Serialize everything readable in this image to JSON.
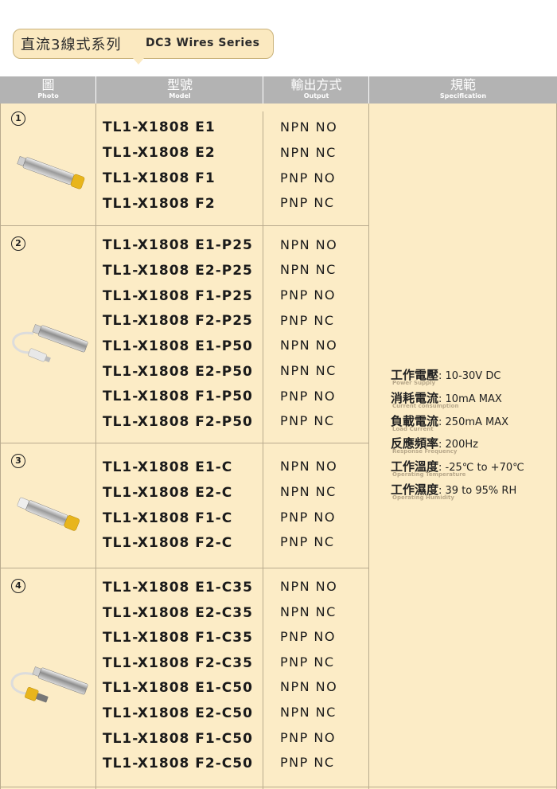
{
  "title": {
    "cn": "直流3線式系列",
    "en": "DC3 Wires Series"
  },
  "header": {
    "photo": {
      "cn": "圖",
      "en": "Photo"
    },
    "model": {
      "cn": "型號",
      "en": "Model"
    },
    "output": {
      "cn": "輸出方式",
      "en": "Output"
    },
    "spec": {
      "cn": "規範",
      "en": "Specification"
    }
  },
  "groups": [
    {
      "number": "1",
      "rows": [
        {
          "model": "TL1-X1808 E1",
          "output": "NPN NO"
        },
        {
          "model": "TL1-X1808 E2",
          "output": "NPN NC"
        },
        {
          "model": "TL1-X1808 F1",
          "output": "PNP NO"
        },
        {
          "model": "TL1-X1808 F2",
          "output": "PNP NC"
        }
      ]
    },
    {
      "number": "2",
      "rows": [
        {
          "model": "TL1-X1808 E1-P25",
          "output": "NPN NO"
        },
        {
          "model": "TL1-X1808 E2-P25",
          "output": "NPN NC"
        },
        {
          "model": "TL1-X1808 F1-P25",
          "output": "PNP NO"
        },
        {
          "model": "TL1-X1808 F2-P25",
          "output": "PNP NC"
        },
        {
          "model": "TL1-X1808 E1-P50",
          "output": "NPN NO"
        },
        {
          "model": "TL1-X1808 E2-P50",
          "output": "NPN NC"
        },
        {
          "model": "TL1-X1808 F1-P50",
          "output": "PNP NO"
        },
        {
          "model": "TL1-X1808 F2-P50",
          "output": "PNP NC"
        }
      ]
    },
    {
      "number": "3",
      "rows": [
        {
          "model": "TL1-X1808 E1-C",
          "output": "NPN NO"
        },
        {
          "model": "TL1-X1808 E2-C",
          "output": "NPN NC"
        },
        {
          "model": "TL1-X1808 F1-C",
          "output": "PNP NO"
        },
        {
          "model": "TL1-X1808 F2-C",
          "output": "PNP NC"
        }
      ]
    },
    {
      "number": "4",
      "rows": [
        {
          "model": "TL1-X1808 E1-C35",
          "output": "NPN NO"
        },
        {
          "model": "TL1-X1808 E2-C35",
          "output": "NPN NC"
        },
        {
          "model": "TL1-X1808 F1-C35",
          "output": "PNP NO"
        },
        {
          "model": "TL1-X1808 F2-C35",
          "output": "PNP NC"
        },
        {
          "model": "TL1-X1808 E1-C50",
          "output": "NPN NO"
        },
        {
          "model": "TL1-X1808 E2-C50",
          "output": "NPN NC"
        },
        {
          "model": "TL1-X1808 F1-C50",
          "output": "PNP NO"
        },
        {
          "model": "TL1-X1808 F2-C50",
          "output": "PNP NC"
        }
      ]
    }
  ],
  "specs": [
    {
      "label": "工作電壓",
      "value": "10-30V DC",
      "sub": "Power Supply"
    },
    {
      "label": "消耗電流",
      "value": "10mA MAX",
      "sub": "Current consumption"
    },
    {
      "label": "負載電流",
      "value": "250mA MAX",
      "sub": "Load Current"
    },
    {
      "label": "反應頻率",
      "value": "200Hz",
      "sub": "Response Frequency"
    },
    {
      "label": "工作溫度",
      "value": "-25℃ to +70℃",
      "sub": "Operating Temperature"
    },
    {
      "label": "工作濕度",
      "value": "39 to 95% RH",
      "sub": "Operating Humidity"
    }
  ],
  "colors": {
    "title_bg": "#fbe9c0",
    "header_bg": "#b3b3b3",
    "table_bg": "#fcecc6",
    "sensor_cap": "#e8b51c"
  }
}
